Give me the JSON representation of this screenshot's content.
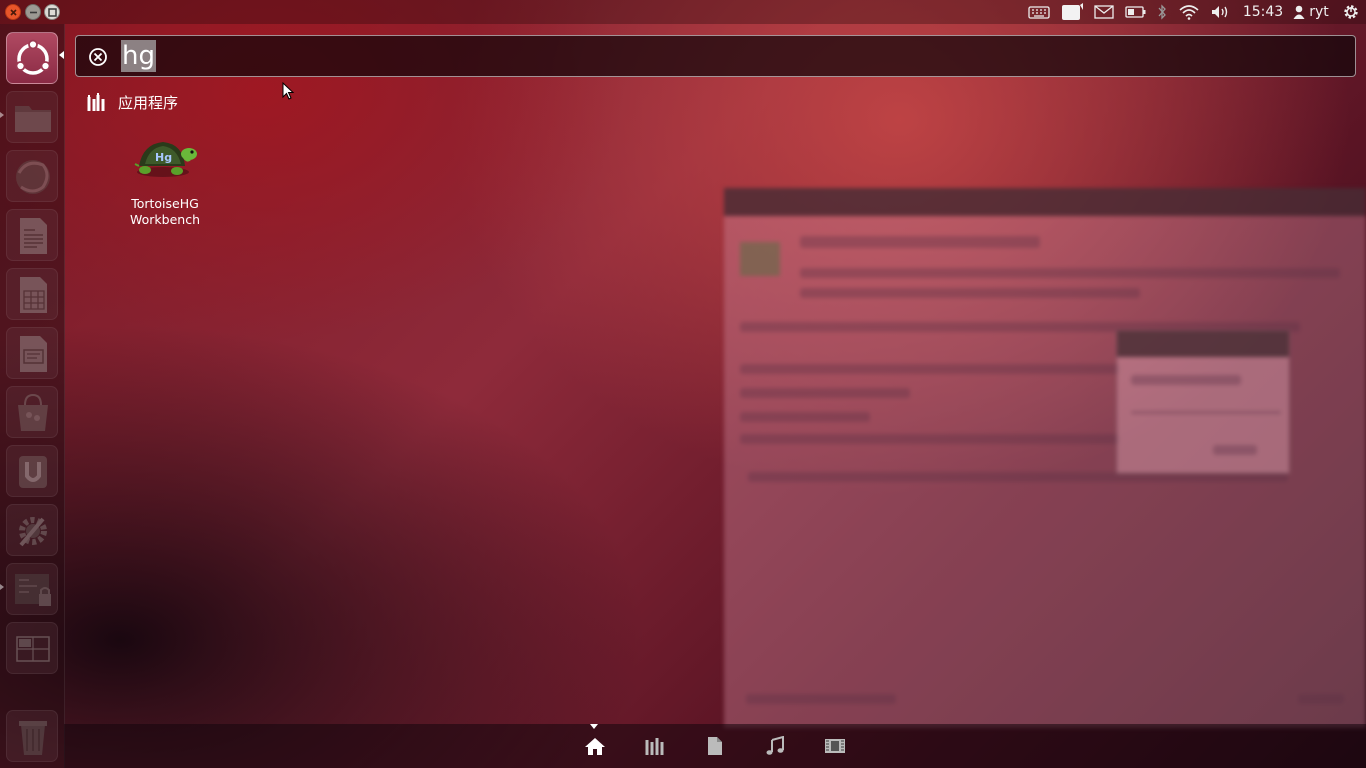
{
  "top_panel": {
    "window_controls": [
      "close",
      "minimize",
      "maximize"
    ],
    "tray_icons": [
      "keyboard-icon",
      "messaging-icon",
      "mail-icon",
      "battery-icon",
      "bluetooth-icon",
      "wifi-icon",
      "volume-icon"
    ],
    "clock": "15:43",
    "user": "ryt",
    "session_icon": "gear-power-icon"
  },
  "launcher": {
    "items": [
      {
        "name": "dash-home",
        "icon": "ubuntu-logo-icon"
      },
      {
        "name": "files",
        "icon": "folder-icon"
      },
      {
        "name": "firefox",
        "icon": "firefox-icon"
      },
      {
        "name": "writer",
        "icon": "document-icon"
      },
      {
        "name": "calc",
        "icon": "spreadsheet-icon"
      },
      {
        "name": "impress",
        "icon": "presentation-icon"
      },
      {
        "name": "software-center",
        "icon": "shopping-bag-icon"
      },
      {
        "name": "ubuntu-one",
        "icon": "ubuntu-one-icon"
      },
      {
        "name": "system-settings",
        "icon": "gear-wrench-icon"
      },
      {
        "name": "additional-drivers",
        "icon": "circuit-lock-icon"
      },
      {
        "name": "workspace-switcher",
        "icon": "workspace-icon"
      },
      {
        "name": "trash",
        "icon": "trash-icon"
      }
    ]
  },
  "dash": {
    "search": {
      "value": "hg"
    },
    "category": {
      "label": "应用程序",
      "icon": "applications-icon"
    },
    "results": [
      {
        "label_line1": "TortoiseHG",
        "label_line2": "Workbench",
        "icon": "tortoise-icon"
      }
    ]
  },
  "lens_bar": {
    "lenses": [
      "home-icon",
      "applications-icon",
      "files-icon",
      "music-icon",
      "video-icon"
    ],
    "active": "home-icon"
  },
  "colors": {
    "accent": "#b04a62",
    "wallpaper_red": "#8e2a3a"
  }
}
